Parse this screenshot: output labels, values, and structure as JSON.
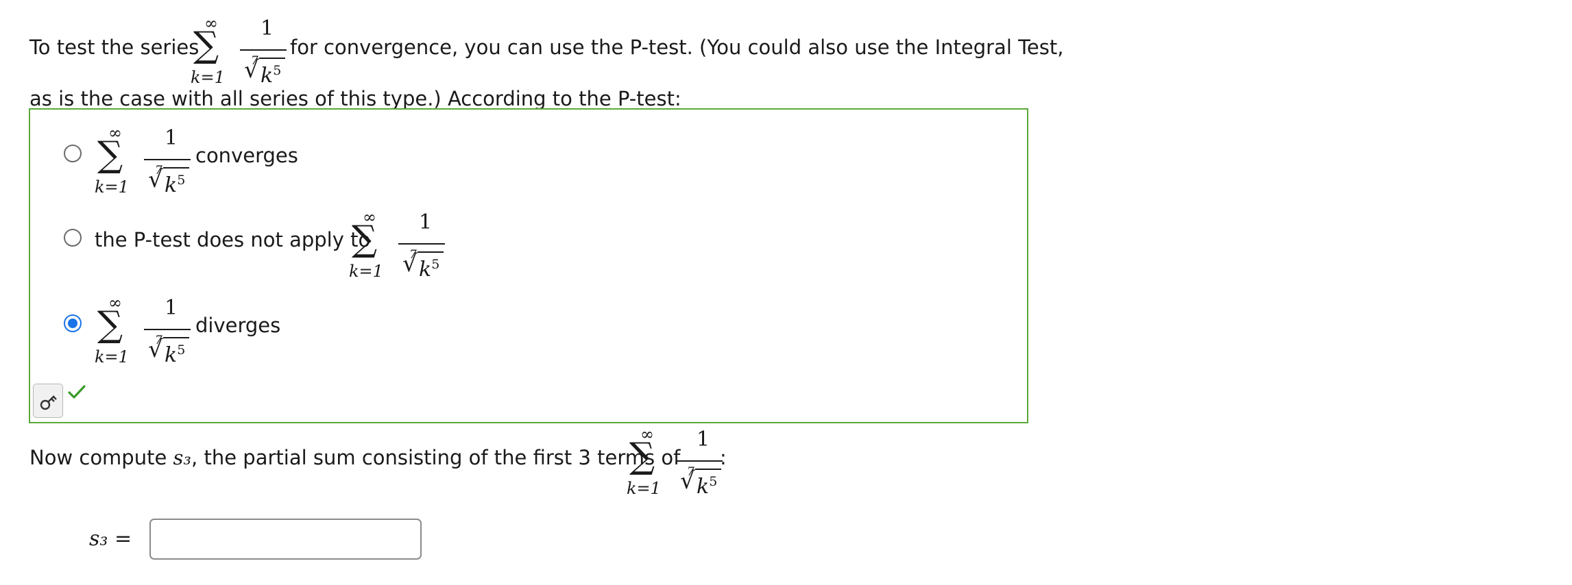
{
  "intro": {
    "before_series": "To test the series",
    "after_series": "for convergence, you can use the P-test. (You could also use the Integral Test,",
    "line2": "as is the case with all series of this type.) According to the P-test:"
  },
  "series": {
    "upper": "∞",
    "sigma": "∑",
    "lower": "k=1",
    "numerator": "1",
    "root_index": "7",
    "radicand_base": "k",
    "radicand_exp": "5"
  },
  "options": [
    {
      "label": "converges",
      "checked": false
    },
    {
      "label": "the P-test does not apply to",
      "checked": false
    },
    {
      "label": "diverges",
      "checked": true
    }
  ],
  "partial": {
    "text": "Now compute",
    "var": "s₃",
    "text2": ", the partial sum consisting of the first 3 terms of",
    "colon": ":",
    "input_label": "s₃ =",
    "input_value": ""
  },
  "colors": {
    "correct_border": "#5aa838",
    "radio_selected": "#1a73e8",
    "check": "#3a9a2a"
  },
  "icons": {
    "key": "key-icon",
    "check": "check-icon"
  }
}
